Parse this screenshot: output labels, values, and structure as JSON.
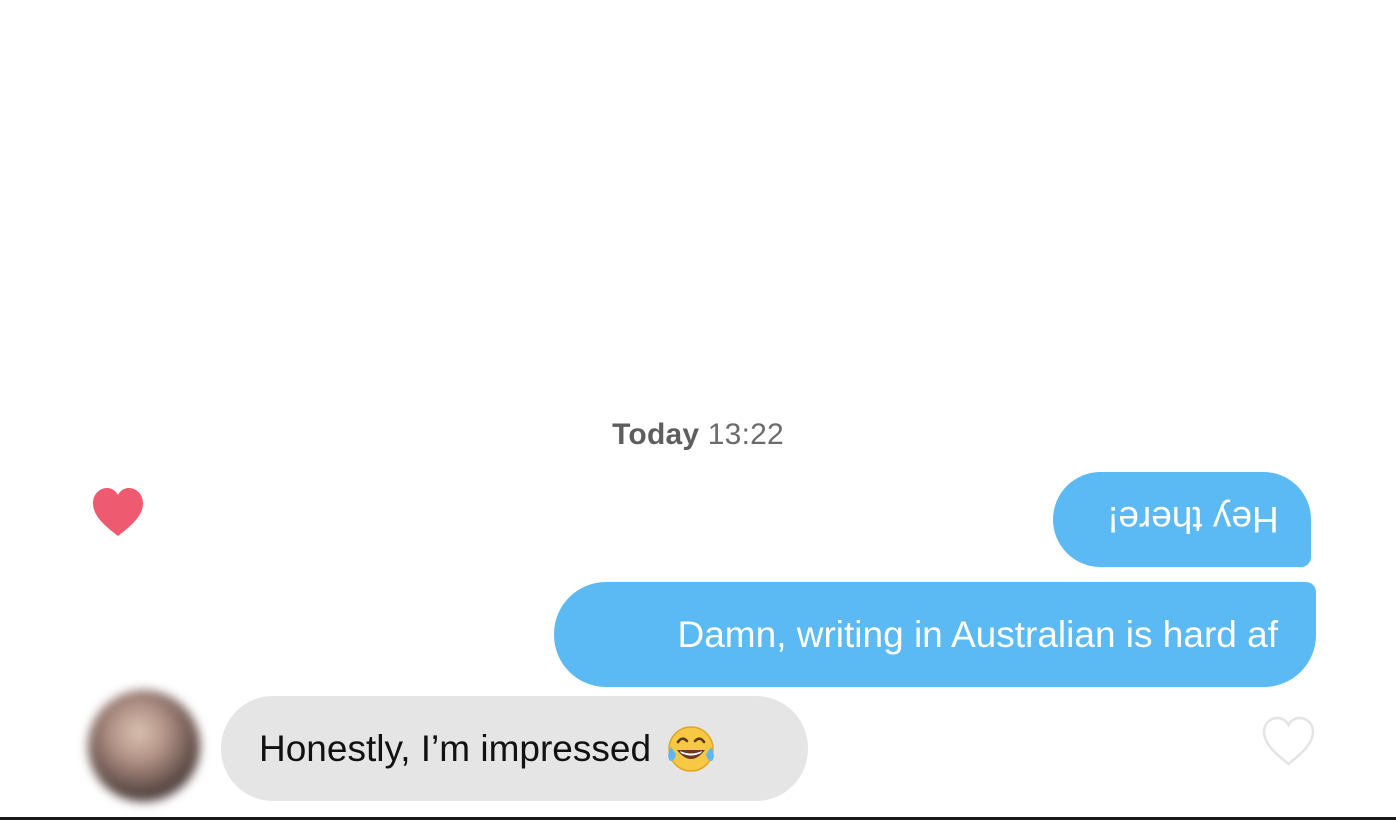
{
  "timestamp": {
    "day": "Today",
    "time": "13:22"
  },
  "messages": [
    {
      "sender": "me",
      "text": "Hey there!",
      "rendered_upside_down": true
    },
    {
      "sender": "me",
      "text": "Damn, writing in Australian is hard af"
    },
    {
      "sender": "match",
      "text": "Honestly, I’m impressed",
      "emoji": "face-with-tears-of-joy"
    }
  ],
  "icons": {
    "liked_heart": "heart-filled-icon",
    "like_button": "heart-outline-icon"
  },
  "colors": {
    "sent_bubble": "#5bb9f4",
    "received_bubble": "#e5e5e5",
    "heart": "#ee5a6f",
    "timestamp_text": "#6b6b6b"
  }
}
